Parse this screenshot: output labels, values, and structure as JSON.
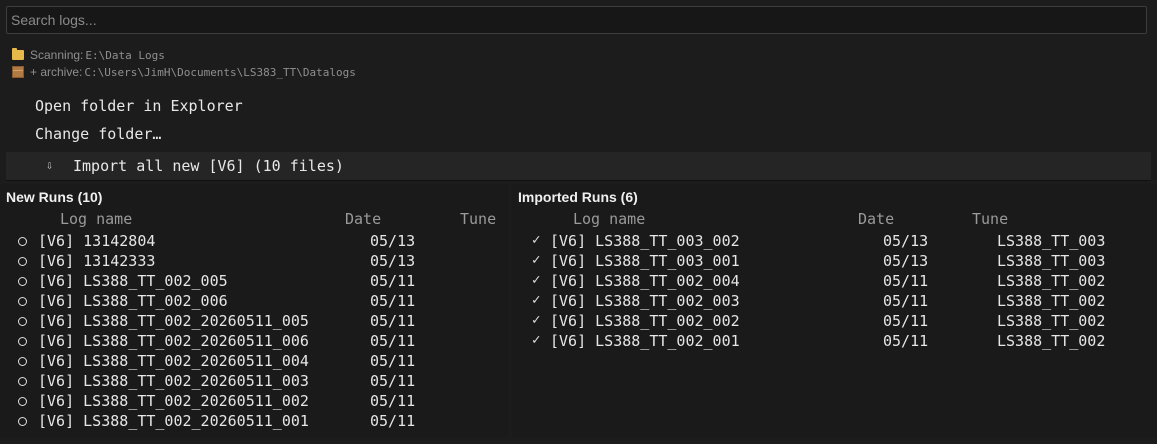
{
  "search": {
    "placeholder": "Search logs..."
  },
  "scan": {
    "scanning_label": "Scanning:",
    "scanning_path": "E:\\Data Logs",
    "archive_label": "+ archive:",
    "archive_path": "C:\\Users\\JimH\\Documents\\LS383_TT\\Datalogs"
  },
  "menu": {
    "open_folder": "Open folder in Explorer",
    "change_folder": "Change folder…"
  },
  "import": {
    "arrow": "⇩",
    "label": "Import all new [V6] (10 files)"
  },
  "new_runs": {
    "title": "New Runs (10)",
    "headers": {
      "log": "Log name",
      "date": "Date",
      "tune": "Tune"
    },
    "rows": [
      {
        "name": "[V6] 13142804",
        "date": "05/13",
        "tune": ""
      },
      {
        "name": "[V6] 13142333",
        "date": "05/13",
        "tune": ""
      },
      {
        "name": "[V6] LS388_TT_002_005",
        "date": "05/11",
        "tune": ""
      },
      {
        "name": "[V6] LS388_TT_002_006",
        "date": "05/11",
        "tune": ""
      },
      {
        "name": "[V6] LS388_TT_002_20260511_005",
        "date": "05/11",
        "tune": ""
      },
      {
        "name": "[V6] LS388_TT_002_20260511_006",
        "date": "05/11",
        "tune": ""
      },
      {
        "name": "[V6] LS388_TT_002_20260511_004",
        "date": "05/11",
        "tune": ""
      },
      {
        "name": "[V6] LS388_TT_002_20260511_003",
        "date": "05/11",
        "tune": ""
      },
      {
        "name": "[V6] LS388_TT_002_20260511_002",
        "date": "05/11",
        "tune": ""
      },
      {
        "name": "[V6] LS388_TT_002_20260511_001",
        "date": "05/11",
        "tune": ""
      }
    ]
  },
  "imported_runs": {
    "title": "Imported Runs (6)",
    "headers": {
      "log": "Log name",
      "date": "Date",
      "tune": "Tune"
    },
    "check_glyph": "✓",
    "rows": [
      {
        "name": "[V6] LS388_TT_003_002",
        "date": "05/13",
        "tune": "LS388_TT_003"
      },
      {
        "name": "[V6] LS388_TT_003_001",
        "date": "05/13",
        "tune": "LS388_TT_003"
      },
      {
        "name": "[V6] LS388_TT_002_004",
        "date": "05/11",
        "tune": "LS388_TT_002"
      },
      {
        "name": "[V6] LS388_TT_002_003",
        "date": "05/11",
        "tune": "LS388_TT_002"
      },
      {
        "name": "[V6] LS388_TT_002_002",
        "date": "05/11",
        "tune": "LS388_TT_002"
      },
      {
        "name": "[V6] LS388_TT_002_001",
        "date": "05/11",
        "tune": "LS388_TT_002"
      }
    ]
  }
}
